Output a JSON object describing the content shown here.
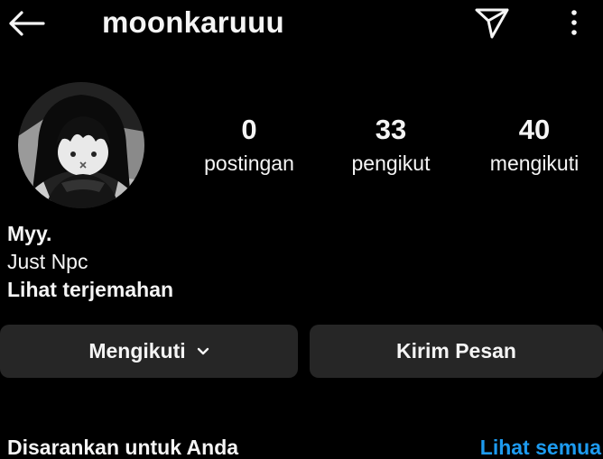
{
  "header": {
    "username": "moonkaruuu",
    "back_icon": "arrow-left-icon",
    "send_icon": "paper-plane-icon",
    "more_icon": "vertical-dots-icon"
  },
  "profile": {
    "avatar_desc": "avatar",
    "stats": [
      {
        "value": "0",
        "label": "postingan"
      },
      {
        "value": "33",
        "label": "pengikut"
      },
      {
        "value": "40",
        "label": "mengikuti"
      }
    ],
    "bio": {
      "name": "Myy.",
      "text": "Just Npc",
      "translate_label": "Lihat terjemahan"
    }
  },
  "actions": {
    "follow_label": "Mengikuti",
    "message_label": "Kirim Pesan"
  },
  "suggested": {
    "title": "Disarankan untuk Anda",
    "see_all_label": "Lihat semua"
  },
  "colors": {
    "background": "#000000",
    "button_bg": "#262626",
    "text": "#f5f5f5",
    "link": "#1d9bf0"
  }
}
